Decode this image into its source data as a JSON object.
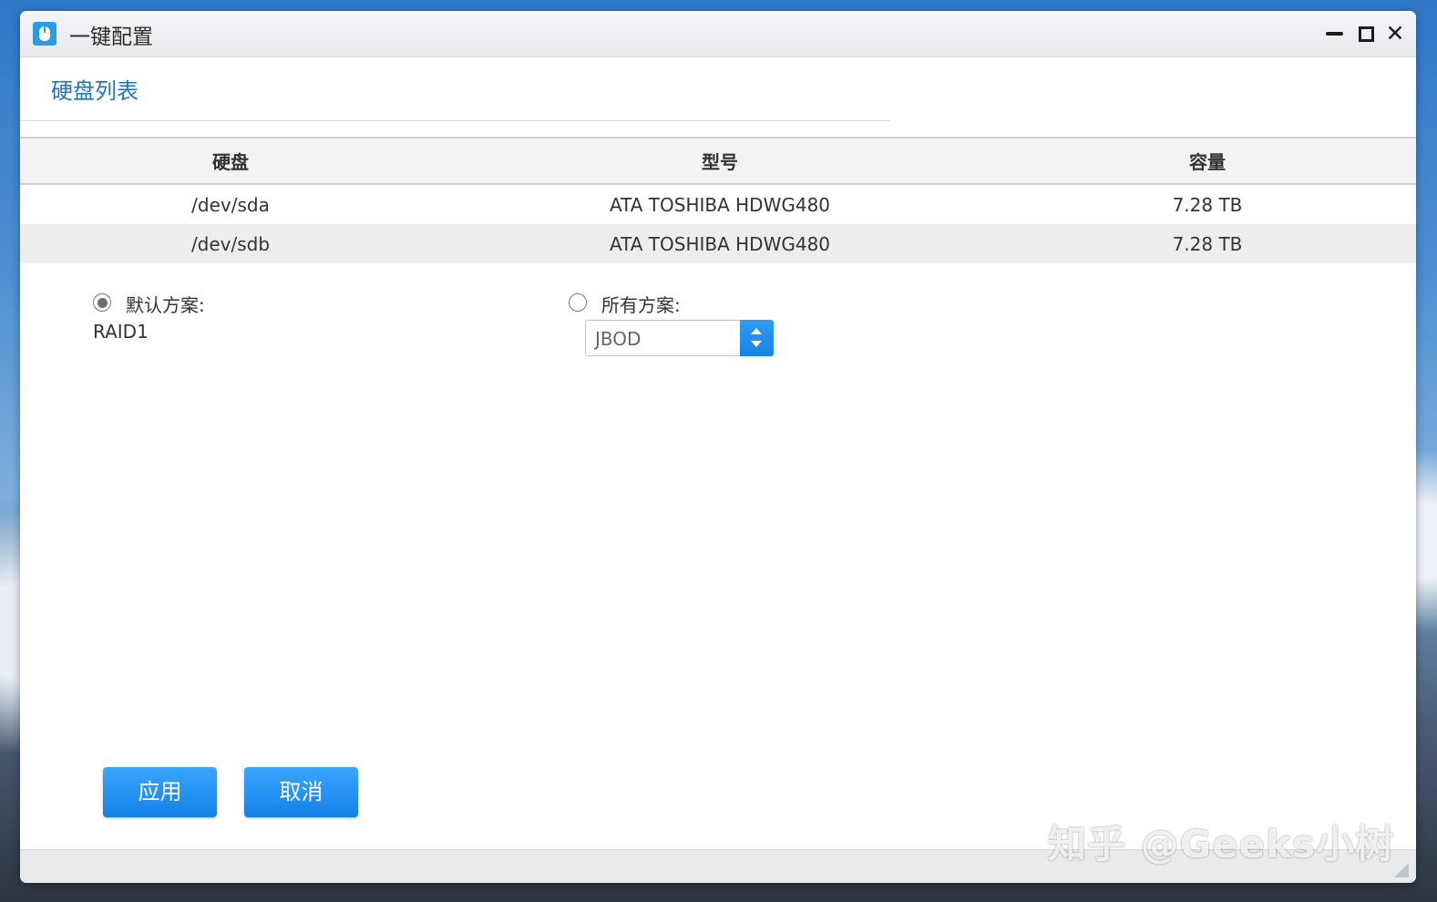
{
  "window": {
    "title": "一键配置",
    "app_icon": "mouse-icon"
  },
  "section": {
    "title": "硬盘列表"
  },
  "table": {
    "columns": [
      "硬盘",
      "型号",
      "容量"
    ],
    "rows": [
      [
        "/dev/sda",
        "ATA TOSHIBA HDWG480",
        "7.28 TB"
      ],
      [
        "/dev/sdb",
        "ATA TOSHIBA HDWG480",
        "7.28 TB"
      ]
    ]
  },
  "options": {
    "default_label": "默认方案:",
    "default_value": "RAID1",
    "default_selected": true,
    "all_label": "所有方案:",
    "all_selected": false,
    "all_select_value": "JBOD"
  },
  "buttons": {
    "apply": "应用",
    "cancel": "取消"
  },
  "watermark": "知乎 @Geeks小树",
  "colors": {
    "accent": "#1e73c8",
    "button": "#1480e6"
  }
}
